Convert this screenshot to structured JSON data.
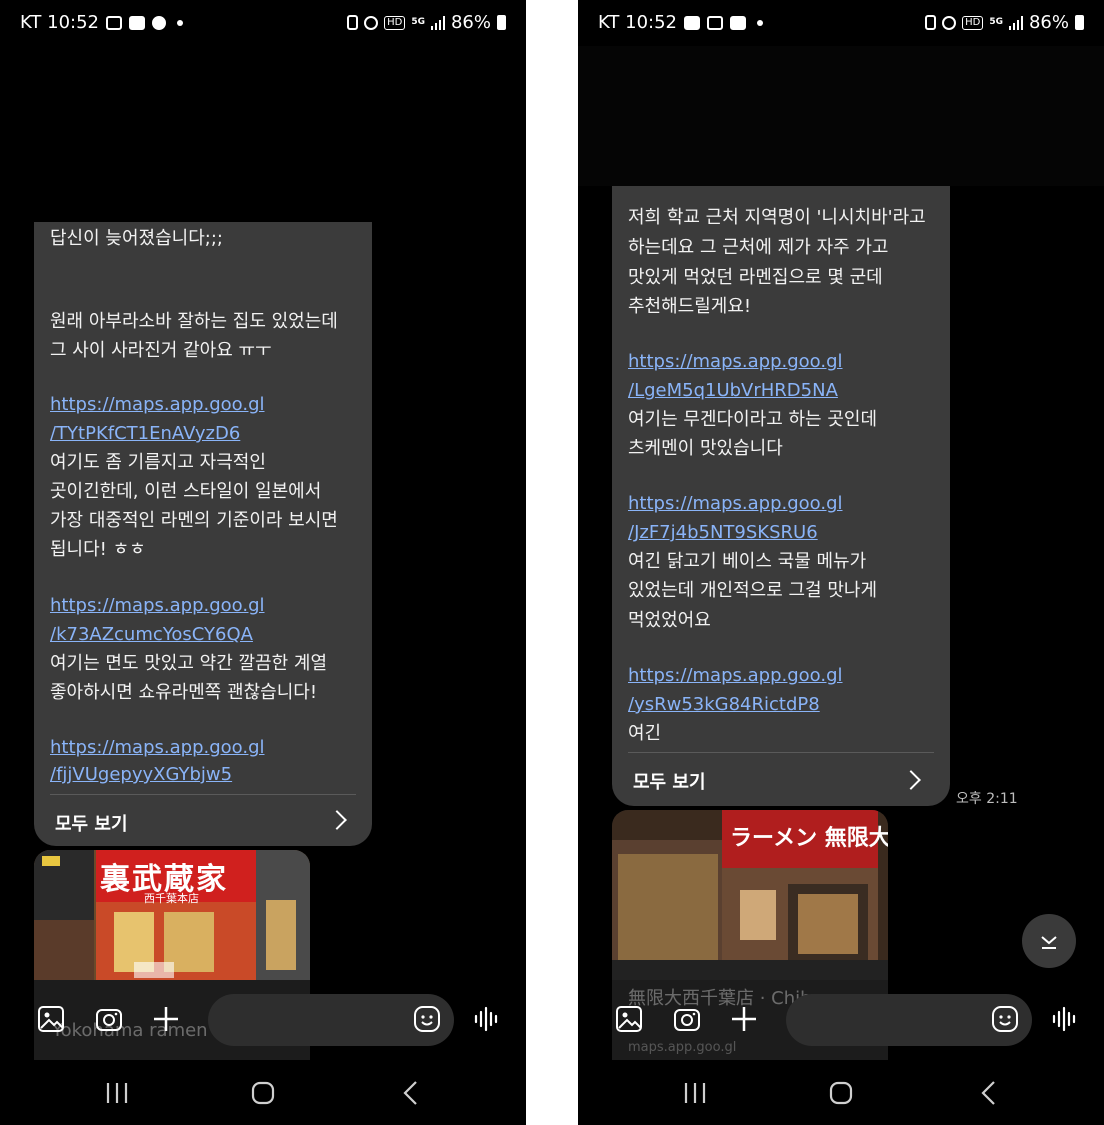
{
  "left": {
    "status": {
      "carrier_time": "KT 10:52",
      "battery": "86%"
    },
    "message": {
      "lines": [
        {
          "text": "답신이 늦어졌습니다;;;",
          "link": false
        },
        {
          "text": "원래 아부라소바 잘하는 집도 있었는데",
          "link": false
        },
        {
          "text": "그 사이 사라진거 같아요 ㅠㅜ",
          "link": false
        },
        {
          "text": "https://maps.app.goo.gl",
          "link": true
        },
        {
          "text": "/TYtPKfCT1EnAVyzD6",
          "link": true
        },
        {
          "text": "여기도 좀 기름지고 자극적인",
          "link": false
        },
        {
          "text": "곳이긴한데, 이런 스타일이 일본에서",
          "link": false
        },
        {
          "text": "가장 대중적인 라멘의 기준이라 보시면",
          "link": false
        },
        {
          "text": "됩니다! ㅎㅎ",
          "link": false
        },
        {
          "text": "https://maps.app.goo.gl",
          "link": true
        },
        {
          "text": "/k73AZcumcYosCY6QA",
          "link": true
        },
        {
          "text": "여기는 면도 맛있고 약간 깔끔한 계열",
          "link": false
        },
        {
          "text": "좋아하시면 쇼유라멘쪽 괜찮습니다!",
          "link": false
        },
        {
          "text": "https://maps.app.goo.gl",
          "link": true
        },
        {
          "text": "/fjjVUgepyyXGYbjw5",
          "link": true
        }
      ],
      "see_all": "모두 보기"
    },
    "preview": {
      "sign": "裏武蔵家",
      "sign_sub": "西千葉本店",
      "caption": "Yokohama ramen"
    }
  },
  "right": {
    "status": {
      "carrier_time": "KT 10:52",
      "battery": "86%"
    },
    "message": {
      "lines": [
        {
          "text": "저희 학교 근처 지역명이 '니시치바'라고",
          "link": false
        },
        {
          "text": "하는데요 그 근처에 제가 자주 가고",
          "link": false
        },
        {
          "text": "맛있게 먹었던 라멘집으로 몇 군데",
          "link": false
        },
        {
          "text": "추천해드릴게요!",
          "link": false
        },
        {
          "text": "https://maps.app.goo.gl",
          "link": true
        },
        {
          "text": "/LgeM5q1UbVrHRD5NA",
          "link": true
        },
        {
          "text": "여기는 무겐다이라고 하는 곳인데",
          "link": false
        },
        {
          "text": "츠케멘이 맛있습니다",
          "link": false
        },
        {
          "text": "https://maps.app.goo.gl",
          "link": true
        },
        {
          "text": "/JzF7j4b5NT9SKSRU6",
          "link": true
        },
        {
          "text": "여긴 닭고기 베이스 국물 메뉴가",
          "link": false
        },
        {
          "text": "있었는데 개인적으로 그걸 맛나게",
          "link": false
        },
        {
          "text": "먹었었어요",
          "link": false
        },
        {
          "text": "https://maps.app.goo.gl",
          "link": true
        },
        {
          "text": "/ysRw53kG84RictdP8",
          "link": true
        },
        {
          "text": "여긴",
          "link": false
        }
      ],
      "see_all": "모두 보기",
      "timestamp": "오후 2:11"
    },
    "preview": {
      "sign": "ラーメン 無限大",
      "caption": "無限大西千葉店 · Chiba",
      "sub": "maps.app.goo.gl"
    }
  },
  "icons": {
    "gallery": "gallery-icon",
    "camera": "camera-icon",
    "plus": "plus-icon",
    "emoji": "emoji-icon",
    "voice": "voice-icon",
    "recent": "recent-apps-icon",
    "home": "home-icon",
    "back": "back-icon",
    "scroll": "chevron-down-icon"
  }
}
